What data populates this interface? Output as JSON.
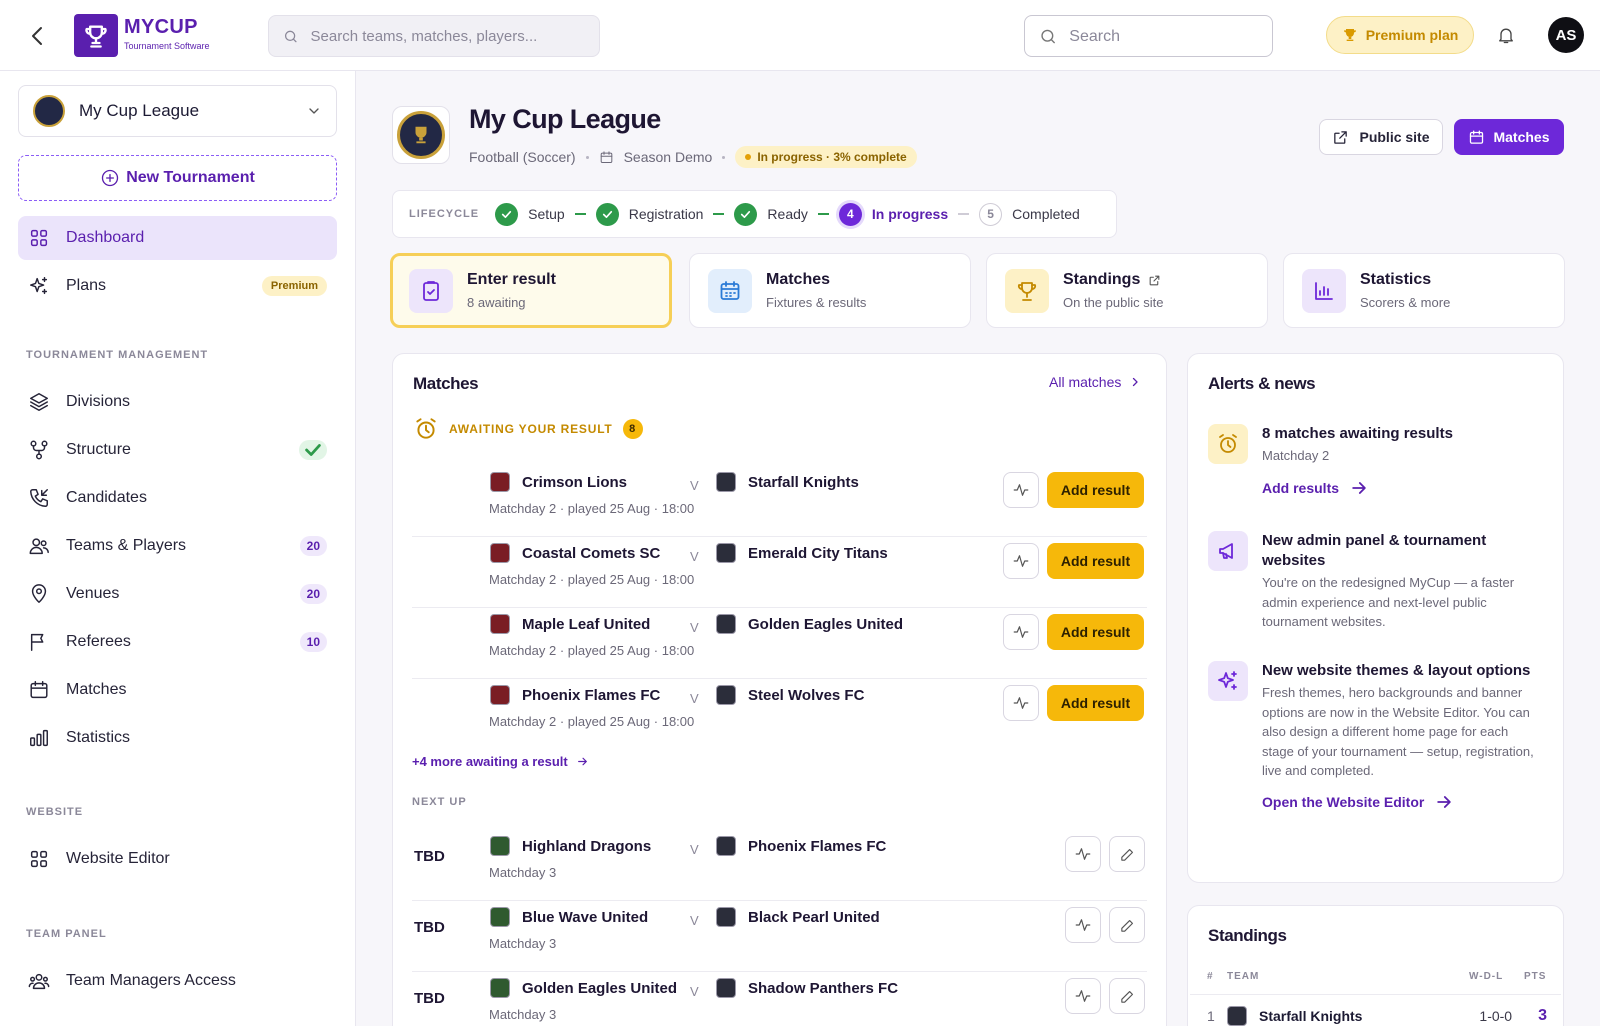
{
  "header": {
    "logo_title": "MYCUP",
    "logo_subtitle": "Tournament Software",
    "global_search_placeholder": "Search teams, matches, players...",
    "search_placeholder": "Search",
    "premium_label": "Premium plan",
    "avatar_initials": "AS"
  },
  "sidebar": {
    "league_name": "My Cup League",
    "new_tournament": "New Tournament",
    "items": [
      {
        "label": "Dashboard"
      },
      {
        "label": "Plans",
        "badge": "Premium"
      }
    ],
    "section_management": "TOURNAMENT MANAGEMENT",
    "management": [
      {
        "label": "Divisions"
      },
      {
        "label": "Structure"
      },
      {
        "label": "Candidates"
      },
      {
        "label": "Teams & Players",
        "count": "20"
      },
      {
        "label": "Venues",
        "count": "20"
      },
      {
        "label": "Referees",
        "count": "10"
      },
      {
        "label": "Matches"
      },
      {
        "label": "Statistics"
      }
    ],
    "section_website": "WEBSITE",
    "website_editor": "Website Editor",
    "section_team_panel": "TEAM PANEL",
    "team_managers": "Team Managers Access"
  },
  "page": {
    "title": "My Cup League",
    "sport": "Football (Soccer)",
    "season": "Season Demo",
    "status": "In progress · 3% complete",
    "public_site": "Public site",
    "matches_button": "Matches"
  },
  "lifecycle": {
    "label": "LIFECYCLE",
    "steps": [
      {
        "label": "Setup"
      },
      {
        "label": "Registration"
      },
      {
        "label": "Ready"
      },
      {
        "num": "4",
        "label": "In progress"
      },
      {
        "num": "5",
        "label": "Completed"
      }
    ]
  },
  "quick": [
    {
      "title": "Enter result",
      "sub": "8 awaiting"
    },
    {
      "title": "Matches",
      "sub": "Fixtures & results"
    },
    {
      "title": "Standings",
      "sub": "On the public site"
    },
    {
      "title": "Statistics",
      "sub": "Scorers & more"
    }
  ],
  "matches": {
    "title": "Matches",
    "all_link": "All matches",
    "awaiting_label": "AWAITING YOUR RESULT",
    "awaiting_count": "8",
    "vs": "V",
    "add_result": "Add result",
    "awaiting": [
      {
        "home": "Crimson Lions",
        "away": "Starfall Knights",
        "sub": "Matchday 2 · played 25 Aug · 18:00"
      },
      {
        "home": "Coastal Comets SC",
        "away": "Emerald City Titans",
        "sub": "Matchday 2 · played 25 Aug · 18:00"
      },
      {
        "home": "Maple Leaf United",
        "away": "Golden Eagles United",
        "sub": "Matchday 2 · played 25 Aug · 18:00"
      },
      {
        "home": "Phoenix Flames FC",
        "away": "Steel Wolves FC",
        "sub": "Matchday 2 · played 25 Aug · 18:00"
      }
    ],
    "more_awaiting": "+4 more awaiting a result",
    "next_up_label": "NEXT UP",
    "next_up": [
      {
        "time": "TBD",
        "home": "Highland Dragons",
        "away": "Phoenix Flames FC",
        "sub": "Matchday 3"
      },
      {
        "time": "TBD",
        "home": "Blue Wave United",
        "away": "Black Pearl United",
        "sub": "Matchday 3"
      },
      {
        "time": "TBD",
        "home": "Golden Eagles United",
        "away": "Shadow Panthers FC",
        "sub": "Matchday 3"
      }
    ]
  },
  "alerts": {
    "title": "Alerts & news",
    "items": [
      {
        "title": "8 matches awaiting results",
        "body": "Matchday 2",
        "link": "Add results"
      },
      {
        "title": "New admin panel & tournament websites",
        "body": "You're on the redesigned MyCup — a faster admin experience and next-level public tournament websites."
      },
      {
        "title": "New website themes & layout options",
        "body": "Fresh themes, hero backgrounds and banner options are now in the Website Editor. You can also design a different home page for each stage of your tournament — setup, registration, live and completed.",
        "link": "Open the Website Editor"
      }
    ]
  },
  "standings": {
    "title": "Standings",
    "col_num": "#",
    "col_team": "TEAM",
    "col_wdl": "W-D-L",
    "col_pts": "PTS",
    "rows": [
      {
        "pos": "1",
        "team": "Starfall Knights",
        "wdl": "1-0-0",
        "pts": "3"
      }
    ]
  },
  "colors": {
    "brand": "#5a1fae",
    "primary_button": "#6d28d9",
    "accent_yellow": "#f6b80a",
    "success": "#2d9a4a"
  }
}
